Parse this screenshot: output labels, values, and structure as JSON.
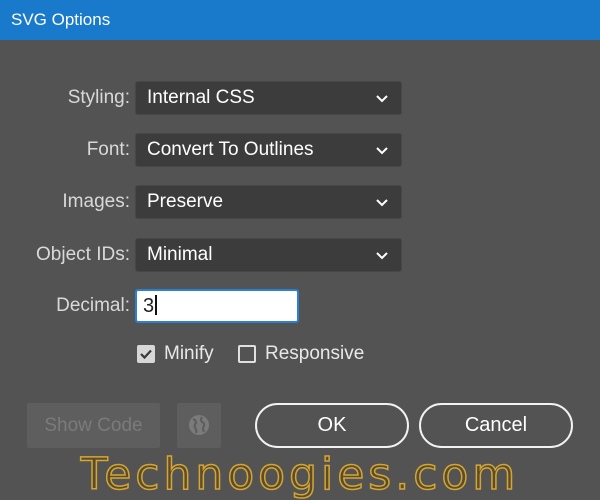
{
  "window": {
    "title": "SVG Options"
  },
  "fields": {
    "styling": {
      "label": "Styling:",
      "value": "Internal CSS"
    },
    "font": {
      "label": "Font:",
      "value": "Convert To Outlines"
    },
    "images": {
      "label": "Images:",
      "value": "Preserve"
    },
    "object_ids": {
      "label": "Object IDs:",
      "value": "Minimal"
    },
    "decimal": {
      "label": "Decimal:",
      "value": "3"
    }
  },
  "checkboxes": {
    "minify": {
      "label": "Minify",
      "checked": true
    },
    "responsive": {
      "label": "Responsive",
      "checked": false
    }
  },
  "buttons": {
    "show_code": "Show Code",
    "ok": "OK",
    "cancel": "Cancel"
  },
  "icons": {
    "dropdown": "chevron-down-icon",
    "globe": "globe-icon",
    "check": "checkmark-icon"
  },
  "watermark": "Technoogies.com",
  "colors": {
    "titlebar": "#1979ca",
    "dialog_bg": "#535353",
    "field_bg": "#3c3c3c",
    "focus_border": "#2a7fd6",
    "watermark": "#d4a534"
  }
}
